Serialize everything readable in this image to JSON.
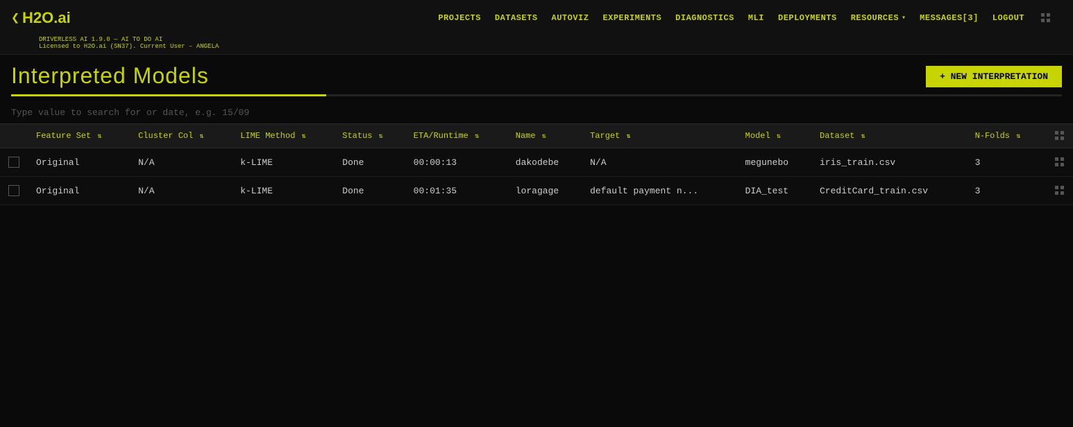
{
  "app": {
    "logo_chevron": "❮",
    "logo_text": "H2O.ai",
    "version_line": "DRIVERLESS AI 1.9.0 — AI TO DO AI",
    "license_line": "Licensed to H2O.ai (SN37). Current User – ANGELA"
  },
  "nav": {
    "items": [
      {
        "label": "PROJECTS",
        "key": "projects"
      },
      {
        "label": "DATASETS",
        "key": "datasets"
      },
      {
        "label": "AUTOVIZ",
        "key": "autoviz"
      },
      {
        "label": "EXPERIMENTS",
        "key": "experiments"
      },
      {
        "label": "DIAGNOSTICS",
        "key": "diagnostics"
      },
      {
        "label": "MLI",
        "key": "mli"
      },
      {
        "label": "DEPLOYMENTS",
        "key": "deployments"
      },
      {
        "label": "RESOURCES",
        "key": "resources"
      }
    ],
    "messages_label": "MESSAGES[3]",
    "logout_label": "LOGOUT"
  },
  "page": {
    "title": "Interpreted Models",
    "new_button_label": "+ NEW INTERPRETATION",
    "search_placeholder": "Type value to search for or date, e.g. 15/09"
  },
  "table": {
    "columns": [
      {
        "label": "Feature Set",
        "key": "feature_set"
      },
      {
        "label": "Cluster Col",
        "key": "cluster_col"
      },
      {
        "label": "LIME Method",
        "key": "lime_method"
      },
      {
        "label": "Status",
        "key": "status"
      },
      {
        "label": "ETA/Runtime",
        "key": "eta_runtime"
      },
      {
        "label": "Name",
        "key": "name"
      },
      {
        "label": "Target",
        "key": "target"
      },
      {
        "label": "Model",
        "key": "model"
      },
      {
        "label": "Dataset",
        "key": "dataset"
      },
      {
        "label": "N-Folds",
        "key": "n_folds"
      }
    ],
    "rows": [
      {
        "feature_set": "Original",
        "cluster_col": "N/A",
        "lime_method": "k-LIME",
        "status": "Done",
        "eta_runtime": "00:00:13",
        "name": "dakodebe",
        "target": "N/A",
        "model": "megunebo",
        "dataset": "iris_train.csv",
        "n_folds": "3"
      },
      {
        "feature_set": "Original",
        "cluster_col": "N/A",
        "lime_method": "k-LIME",
        "status": "Done",
        "eta_runtime": "00:01:35",
        "name": "loragage",
        "target": "default payment n...",
        "model": "DIA_test",
        "dataset": "CreditCard_train.csv",
        "n_folds": "3"
      }
    ]
  }
}
